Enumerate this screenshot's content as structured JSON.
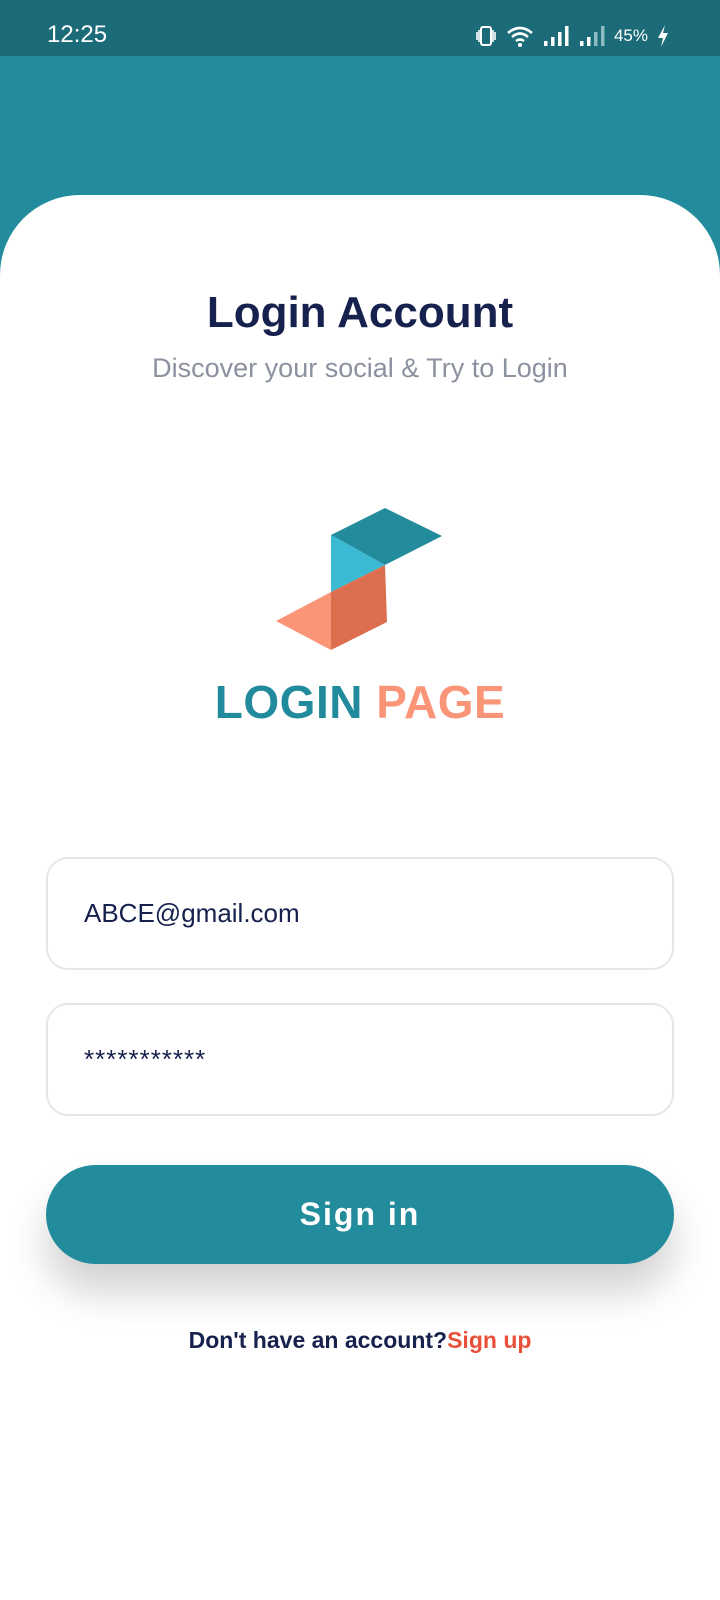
{
  "status_bar": {
    "time": "12:25",
    "icons": [
      "vibrate-icon",
      "wifi-icon",
      "signal-icon",
      "signal-weak-icon",
      "charging-icon"
    ],
    "battery": "45%"
  },
  "header": {
    "title": "Login Account",
    "subtitle": "Discover your social & Try to Login"
  },
  "logo": {
    "word_1": "LOGIN",
    "word_2": "PAGE"
  },
  "form": {
    "email_value": "ABCE@gmail.com",
    "password_value": "***********",
    "signin_label": "Sign in"
  },
  "footer": {
    "prompt": "Don't have an account?",
    "link": "Sign up"
  },
  "colors": {
    "primary": "#228b9c",
    "status_bar": "#1c6b78",
    "accent_orange": "#fa9677",
    "link_red": "#e8503a",
    "text_dark": "#17214d",
    "text_muted": "#8c91a0"
  }
}
